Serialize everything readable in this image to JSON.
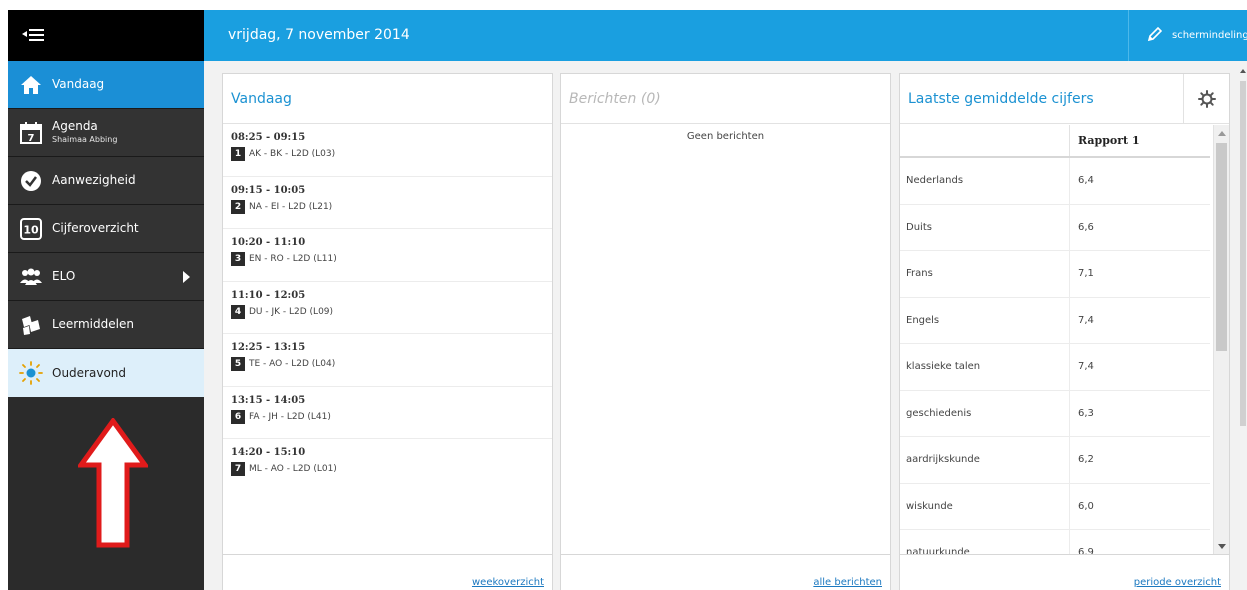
{
  "header": {
    "date": "vrijdag, 7 november 2014",
    "screen_layout_label": "schermindeling"
  },
  "sidebar": {
    "items": [
      {
        "label": "Vandaag",
        "icon": "home-icon"
      },
      {
        "label": "Agenda",
        "sub": "Shaimaa Abbing",
        "icon": "calendar-icon",
        "icon_text": "7"
      },
      {
        "label": "Aanwezigheid",
        "icon": "check-circle-icon"
      },
      {
        "label": "Cijferoverzicht",
        "icon": "grade-ten-icon",
        "icon_text": "10"
      },
      {
        "label": "ELO",
        "icon": "group-icon"
      },
      {
        "label": "Leermiddelen",
        "icon": "books-icon"
      },
      {
        "label": "Ouderavond",
        "icon": "lightbulb-icon"
      }
    ]
  },
  "vandaag": {
    "title": "Vandaag",
    "lessons": [
      {
        "time": "08:25 - 09:15",
        "num": "1",
        "desc": "AK - BK - L2D (L03)"
      },
      {
        "time": "09:15 - 10:05",
        "num": "2",
        "desc": "NA - EI - L2D (L21)"
      },
      {
        "time": "10:20 - 11:10",
        "num": "3",
        "desc": "EN - RO - L2D (L11)"
      },
      {
        "time": "11:10 - 12:05",
        "num": "4",
        "desc": "DU - JK - L2D (L09)"
      },
      {
        "time": "12:25 - 13:15",
        "num": "5",
        "desc": "TE - AO - L2D (L04)"
      },
      {
        "time": "13:15 - 14:05",
        "num": "6",
        "desc": "FA - JH - L2D (L41)"
      },
      {
        "time": "14:20 - 15:10",
        "num": "7",
        "desc": "ML - AO - L2D (L01)"
      }
    ],
    "footer_link": "weekoverzicht"
  },
  "berichten": {
    "title": "Berichten (0)",
    "empty": "Geen berichten",
    "footer_link": "alle berichten"
  },
  "cijfers": {
    "title": "Laatste gemiddelde cijfers",
    "column_header": "Rapport 1",
    "rows": [
      {
        "subject": "Nederlands",
        "grade": "6,4"
      },
      {
        "subject": "Duits",
        "grade": "6,6"
      },
      {
        "subject": "Frans",
        "grade": "7,1"
      },
      {
        "subject": "Engels",
        "grade": "7,4"
      },
      {
        "subject": "klassieke talen",
        "grade": "7,4"
      },
      {
        "subject": "geschiedenis",
        "grade": "6,3"
      },
      {
        "subject": "aardrijkskunde",
        "grade": "6,2"
      },
      {
        "subject": "wiskunde",
        "grade": "6,0"
      },
      {
        "subject": "natuurkunde",
        "grade": "6,9"
      }
    ],
    "footer_link": "periode overzicht"
  },
  "colors": {
    "topbar": "#1a9fe0",
    "sidebar_active": "#1b8fd6",
    "sidebar_bg": "#333333",
    "highlight": "#ddeffa",
    "annotation_arrow": "#e01b1b"
  }
}
